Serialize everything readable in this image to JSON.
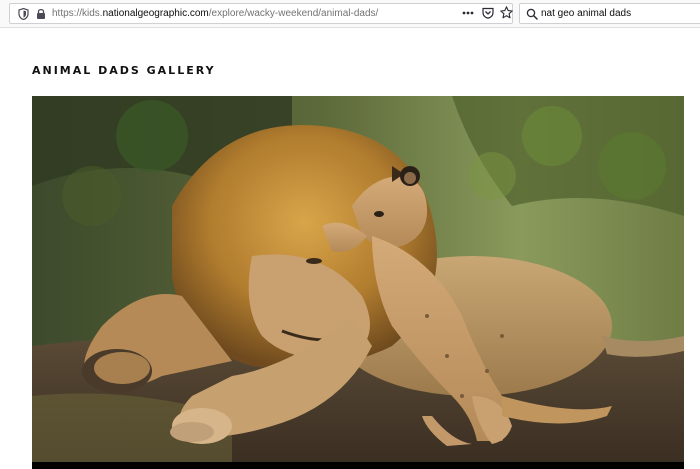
{
  "browser": {
    "url_prefix": "https://kids.",
    "url_host": "nationalgeographic.com",
    "url_path": "/explore/wacky-weekend/animal-dads/",
    "search_value": "nat geo animal dads",
    "icons": [
      "tracking-protection-icon",
      "lock-icon",
      "page-actions-icon",
      "pocket-icon",
      "bookmark-star-icon",
      "search-icon"
    ]
  },
  "page": {
    "title": "ANIMAL DADS GALLERY"
  },
  "colors": {
    "toolbar_bg": "#f9f9fa",
    "pocket": "#ef4056",
    "shield": "#5b5b66"
  }
}
